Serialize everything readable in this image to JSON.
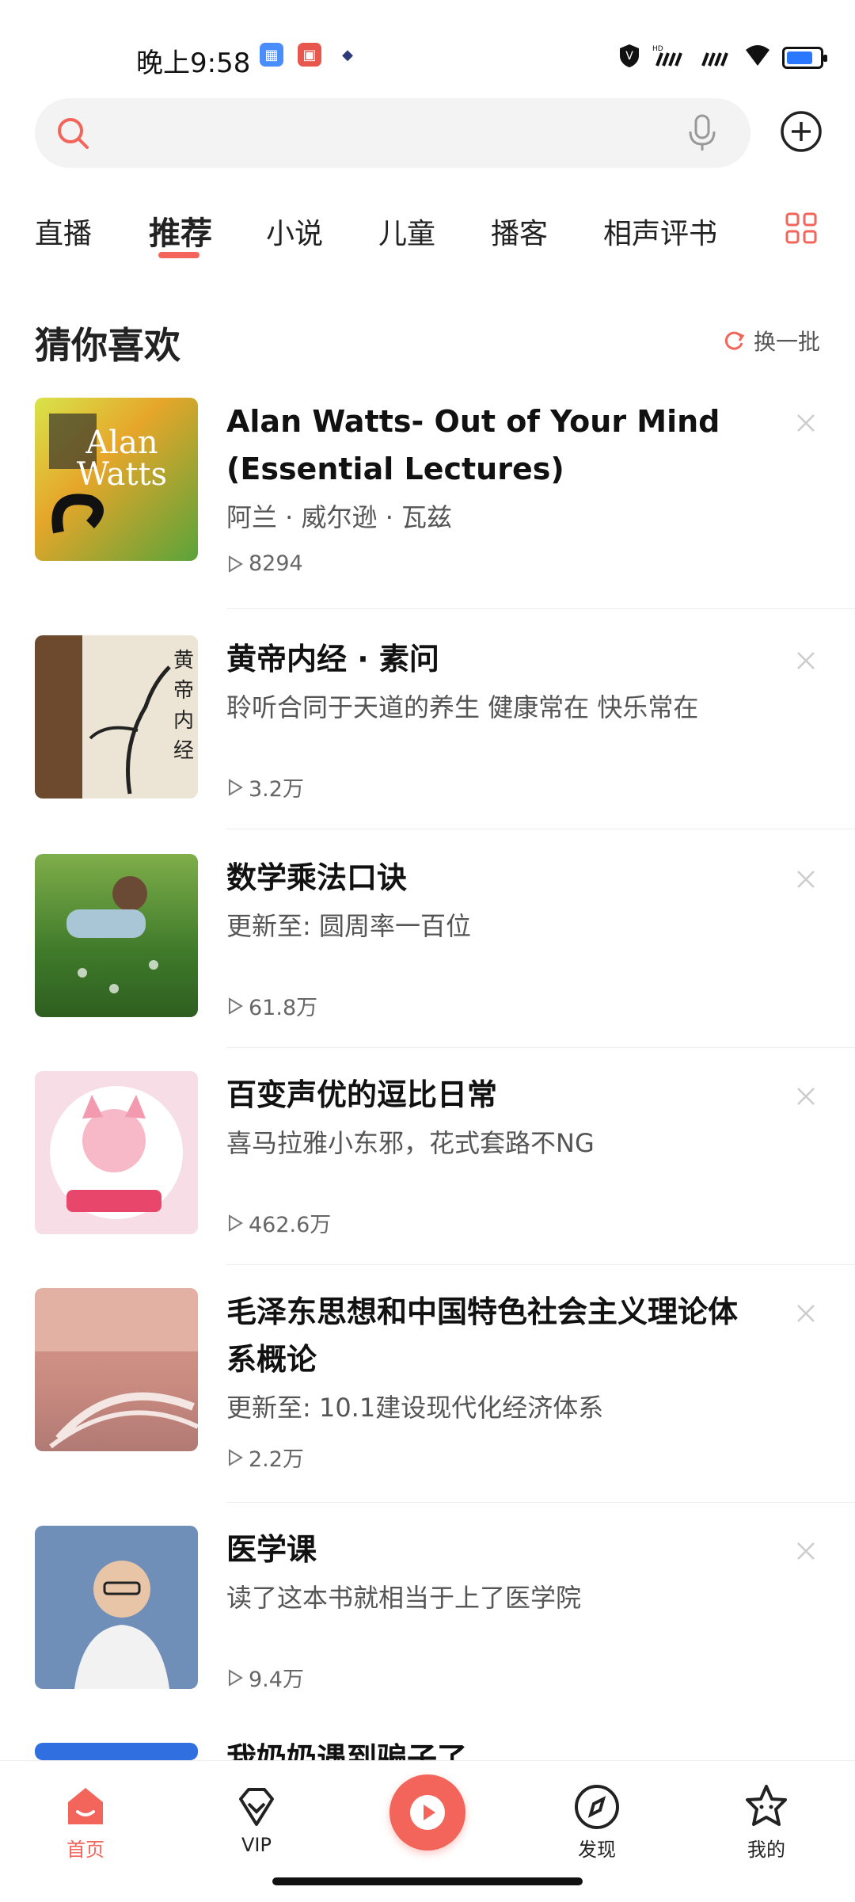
{
  "status_bar": {
    "time": "晚上9:58",
    "signal": "HD",
    "accent_left_apps": [
      "#4a8dff",
      "#e8574d",
      "#2c3a78"
    ]
  },
  "search": {
    "placeholder": ""
  },
  "tabs": [
    {
      "label": "直播",
      "active": false
    },
    {
      "label": "推荐",
      "active": true
    },
    {
      "label": "小说",
      "active": false
    },
    {
      "label": "儿童",
      "active": false
    },
    {
      "label": "播客",
      "active": false
    },
    {
      "label": "相声评书",
      "active": false
    }
  ],
  "section": {
    "title": "猜你喜欢",
    "refresh_label": "换一批"
  },
  "items": [
    {
      "title_line1": "Alan Watts- Out of Your Mind",
      "title_line2": "(Essential Lectures)",
      "subtitle": "阿兰 · 威尔逊 · 瓦兹",
      "plays": "8294"
    },
    {
      "title_line1": "黄帝内经 · 素问",
      "title_line2": "",
      "subtitle": "聆听合同于天道的养生 健康常在 快乐常在",
      "plays": "3.2万"
    },
    {
      "title_line1": "数学乘法口诀",
      "title_line2": "",
      "subtitle": "更新至: 圆周率一百位",
      "plays": "61.8万"
    },
    {
      "title_line1": "百变声优的逗比日常",
      "title_line2": "",
      "subtitle": "喜马拉雅小东邪，花式套路不NG",
      "plays": "462.6万"
    },
    {
      "title_line1": "毛泽东思想和中国特色社会主义理论体",
      "title_line2": "系概论",
      "subtitle": "更新至: 10.1建设现代化经济体系",
      "plays": "2.2万"
    },
    {
      "title_line1": "医学课",
      "title_line2": "",
      "subtitle": "读了这本书就相当于上了医学院",
      "plays": "9.4万"
    },
    {
      "title_line1": "我奶奶遇到骗子了",
      "title_line2": "",
      "subtitle": "",
      "plays": ""
    }
  ],
  "bottom_nav": {
    "home": "首页",
    "vip": "VIP",
    "discover": "发现",
    "mine": "我的"
  },
  "colors": {
    "accent": "#f3655a"
  }
}
